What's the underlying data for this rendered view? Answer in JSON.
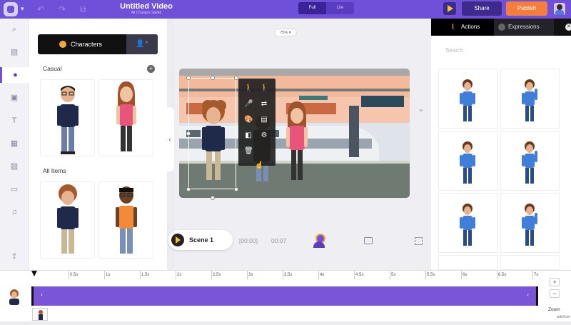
{
  "header": {
    "title": "Untitled Video",
    "subtitle": "All Changes Saved",
    "mode_options": [
      "Full",
      "Lite"
    ],
    "selected_mode": "Full",
    "share_label": "Share",
    "publish_label": "Publish",
    "icons": [
      "app-logo",
      "undo-icon",
      "redo-icon",
      "duplicate-icon",
      "play-preview-icon",
      "user-avatar"
    ]
  },
  "left_rail": {
    "items": [
      "search",
      "media",
      "characters",
      "properties",
      "text",
      "templates",
      "images",
      "backgrounds",
      "music",
      "upload"
    ],
    "active": "characters"
  },
  "library": {
    "tabs": {
      "characters_label": "Characters"
    },
    "casual_label": "Casual",
    "all_items_label": "All Items",
    "colors": {
      "accent": "#6f50d8",
      "tab_bg": "#111111"
    }
  },
  "canvas": {
    "zoom_label": "75% ▾",
    "scene_label": "Scene 1",
    "time_start": "[00:00]",
    "time_end": "00:07"
  },
  "right_panel": {
    "tab_actions": "Actions",
    "tab_expressions": "Expressions",
    "search_placeholder": "Search"
  },
  "timeline": {
    "ticks": [
      "0.5s",
      "1s",
      "1.5s",
      "2s",
      "2.5s",
      "3s",
      "3.5s",
      "4s",
      "4.5s",
      "5s",
      "5.5s",
      "6s",
      "6.5s",
      "7s"
    ],
    "zoom_label": "Zoom",
    "brand": "wikiHow",
    "track_color": "#7b55d8"
  }
}
